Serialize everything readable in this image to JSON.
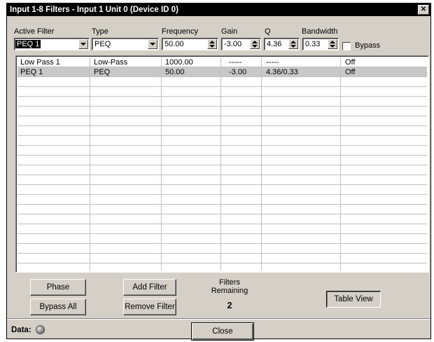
{
  "window": {
    "title": "Input 1-8 Filters - Input 1  Unit 0 (Device ID  0)",
    "close_glyph": "✕"
  },
  "controls": {
    "active_filter": {
      "label": "Active Filter",
      "value": "PEQ 1"
    },
    "type": {
      "label": "Type",
      "value": "PEQ"
    },
    "frequency": {
      "label": "Frequency",
      "value": "50.00"
    },
    "gain": {
      "label": "Gain",
      "value": "-3.00"
    },
    "q": {
      "label": "Q",
      "value": "4.36"
    },
    "bandwidth": {
      "label": "Bandwidth",
      "value": "0.33"
    },
    "bypass": {
      "label": "Bypass",
      "checked": false
    }
  },
  "table": {
    "rows": [
      {
        "name": "Low Pass 1",
        "type": "Low-Pass",
        "frequency": "1000.00",
        "gain": "-----",
        "q": "-----",
        "bypass": "Off",
        "selected": false
      },
      {
        "name": "PEQ 1",
        "type": "PEQ",
        "frequency": "50.00",
        "gain": "-3.00",
        "q": "4.36/0.33",
        "bypass": "Off",
        "selected": true
      }
    ]
  },
  "buttons": {
    "phase": "Phase",
    "bypass_all": "Bypass All",
    "add_filter": "Add Filter",
    "remove_filter": "Remove Filter",
    "table_view": "Table View",
    "close": "Close"
  },
  "filters_remaining": {
    "label": "Filters\nRemaining",
    "line1": "Filters",
    "line2": "Remaining",
    "count": "2"
  },
  "status": {
    "data_label": "Data:"
  },
  "colors": {
    "title_bg": "#000000",
    "face": "#d4d0c8",
    "selected_row": "#c8c8c8"
  }
}
